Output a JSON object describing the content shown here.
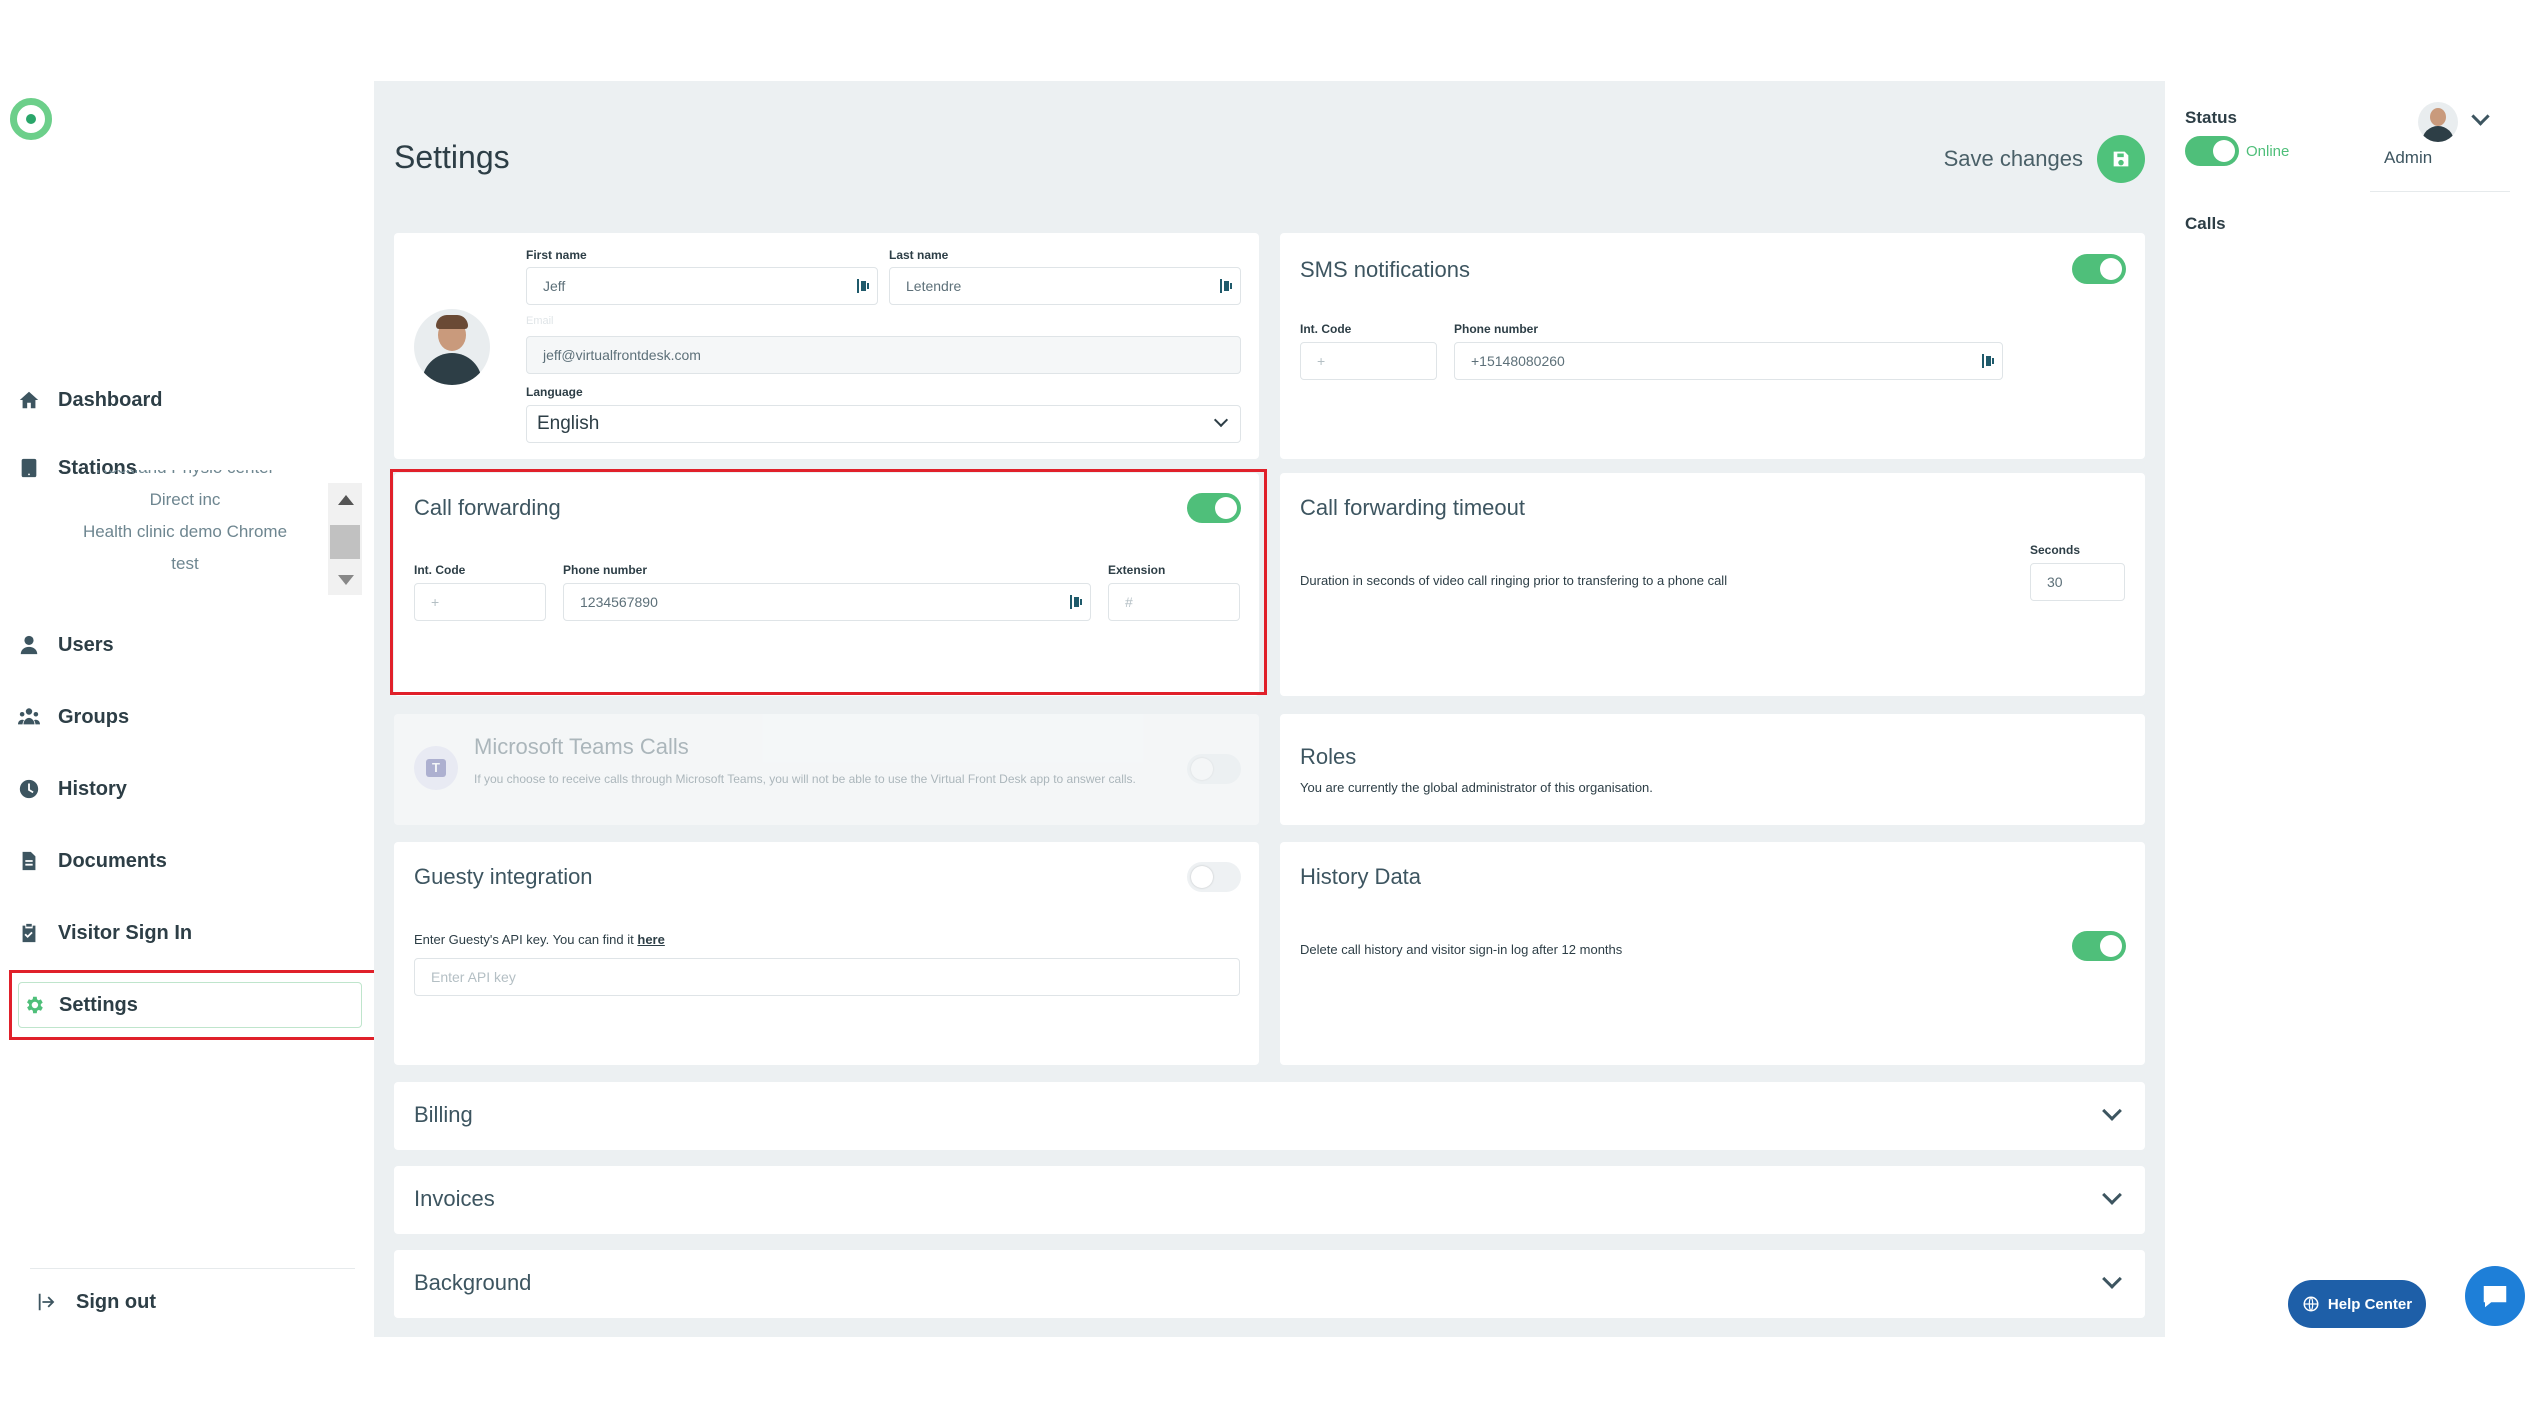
{
  "sidebar": {
    "nav": {
      "dashboard": "Dashboard",
      "stations": "Stations",
      "users": "Users",
      "groups": "Groups",
      "history": "History",
      "documents": "Documents",
      "visitor_sign_in": "Visitor Sign In",
      "settings": "Settings",
      "sign_out": "Sign out"
    },
    "stations": [
      "Rockland Physio center",
      "Direct inc",
      "Health clinic demo Chrome",
      "test"
    ]
  },
  "header": {
    "title": "Settings",
    "save_label": "Save changes"
  },
  "profile": {
    "first_name_label": "First name",
    "first_name": "Jeff",
    "last_name_label": "Last name",
    "last_name": "Letendre",
    "email_label": "Email",
    "email": "jeff@virtualfrontdesk.com",
    "language_label": "Language",
    "language": "English"
  },
  "sms": {
    "title": "SMS notifications",
    "int_code_label": "Int. Code",
    "int_code_placeholder": "+",
    "phone_label": "Phone number",
    "phone": "+15148080260"
  },
  "call_forwarding": {
    "title": "Call forwarding",
    "int_code_label": "Int. Code",
    "int_code_placeholder": "+",
    "phone_label": "Phone number",
    "phone": "1234567890",
    "extension_label": "Extension",
    "extension_placeholder": "#"
  },
  "timeout": {
    "title": "Call forwarding timeout",
    "description": "Duration in seconds of video call ringing prior to transfering to a phone call",
    "seconds_label": "Seconds",
    "seconds": "30"
  },
  "teams": {
    "title": "Microsoft Teams Calls",
    "description": "If you choose to receive calls through Microsoft Teams, you will not be able to use the Virtual Front Desk app to answer calls."
  },
  "roles": {
    "title": "Roles",
    "description": "You are currently the global administrator of this organisation."
  },
  "guesty": {
    "title": "Guesty integration",
    "description": "Enter Guesty's API key. You can find it ",
    "link": "here",
    "placeholder": "Enter API key"
  },
  "history_data": {
    "title": "History Data",
    "description": "Delete call history and visitor sign-in log after 12 months"
  },
  "sections": {
    "billing": "Billing",
    "invoices": "Invoices",
    "background": "Background"
  },
  "right_panel": {
    "status_label": "Status",
    "status_value": "Online",
    "user_role": "Admin",
    "calls_label": "Calls"
  },
  "help": {
    "label": "Help Center"
  },
  "colors": {
    "accent": "#4fbf7a",
    "highlight": "#e0202a",
    "help_button": "#1e5fa8"
  }
}
